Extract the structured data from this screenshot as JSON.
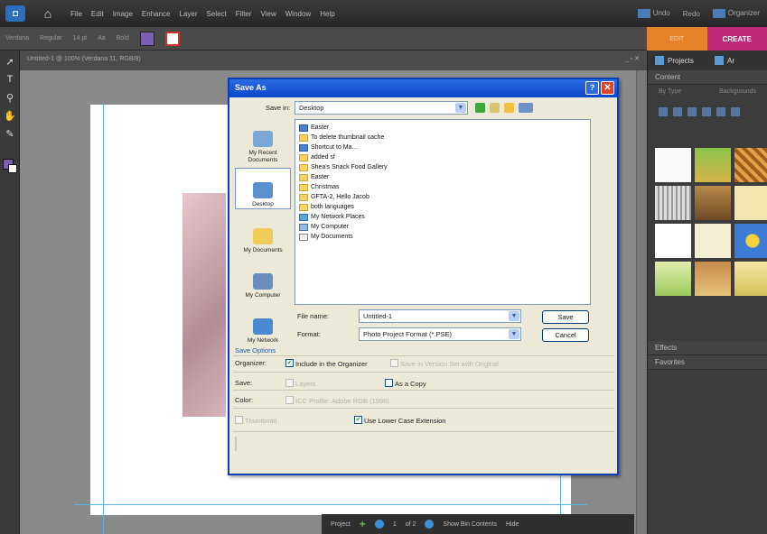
{
  "menubar": {
    "menus": [
      "File",
      "Edit",
      "Image",
      "Enhance",
      "Layer",
      "Select",
      "Filter",
      "View",
      "Window",
      "Help"
    ],
    "right_items": [
      "Undo",
      "Redo",
      "Organizer"
    ]
  },
  "options_bar": {
    "items": [
      "Verdana",
      "Regular",
      "14 pt",
      "Aa",
      "Bold"
    ]
  },
  "mode_tabs": {
    "edit": "EDIT",
    "create": "CREATE"
  },
  "document": {
    "title": "Untitled-1 @ 100% (Verdana 11, RGB/8)"
  },
  "project_bin": {
    "label": "Project",
    "page_count": "1",
    "of_label": "of 2",
    "show_bin": "Show Bin Contents",
    "hide": "Hide"
  },
  "right_panel": {
    "tab_projects": "Projects",
    "tab_artwork": "Ar",
    "content_header": "Content",
    "filter_by": "By Type",
    "filter_value": "Backgrounds",
    "effects_header": "Effects",
    "favorites_header": "Favorites"
  },
  "dialog": {
    "title": "Save As",
    "save_in_label": "Save in:",
    "save_in_value": "Desktop",
    "places": [
      "My Recent Documents",
      "Desktop",
      "My Documents",
      "My Computer",
      "My Network"
    ],
    "files": [
      {
        "name": "Easter",
        "type": "app"
      },
      {
        "name": "To delete thumbnail cache",
        "type": "folder"
      },
      {
        "name": "Shortcut to Ma&#8230;",
        "type": "app"
      },
      {
        "name": "added sf",
        "type": "folder"
      },
      {
        "name": "Shea's Snack Food Gallery",
        "type": "folder"
      },
      {
        "name": "Easter",
        "type": "folder"
      },
      {
        "name": "Christmas",
        "type": "folder"
      },
      {
        "name": "GFTA-2, Hello Jacob",
        "type": "folder"
      },
      {
        "name": "both languages",
        "type": "folder"
      },
      {
        "name": "My Network Places",
        "type": "net"
      },
      {
        "name": "My Computer",
        "type": "comp"
      },
      {
        "name": "My Documents",
        "type": "doc"
      }
    ],
    "file_name_label": "File name:",
    "file_name_value": "Untitled-1",
    "format_label": "Format:",
    "format_value": "Photo Project Format (*.PSE)",
    "save_button": "Save",
    "cancel_button": "Cancel",
    "save_options_header": "Save Options",
    "organizer_label": "Organizer:",
    "include_organizer": "Include in the Organizer",
    "save_version_set": "Save in Version Set with Original",
    "save_label": "Save:",
    "layers": "Layers",
    "as_a_copy": "As a Copy",
    "color_label": "Color:",
    "icc_profile": "ICC Profile: Adobe RGB (1998)",
    "thumbnail": "Thumbnail",
    "use_lower_case": "Use Lower Case Extension"
  }
}
